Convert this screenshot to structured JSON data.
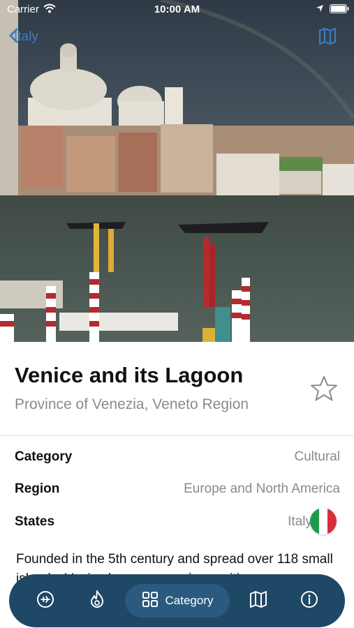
{
  "status_bar": {
    "carrier": "Carrier",
    "time": "10:00 AM"
  },
  "nav": {
    "back_label": "Italy",
    "accent_color": "#3c7cc0"
  },
  "site": {
    "title": "Venice and its Lagoon",
    "subtitle": "Province of Venezia, Veneto Region",
    "favorite_icon": "star-outline-icon"
  },
  "details": [
    {
      "label": "Category",
      "value": "Cultural"
    },
    {
      "label": "Region",
      "value": "Europe and North America"
    },
    {
      "label": "States",
      "value": "Italy",
      "flag": "italy-flag-icon"
    }
  ],
  "description": "Founded in the 5th century and spread over 118 small islands, Venice became a major maritime",
  "tab_bar": {
    "background": "#1f4766",
    "items": [
      {
        "icon": "airplane-icon",
        "label": ""
      },
      {
        "icon": "fire-icon",
        "label": ""
      },
      {
        "icon": "grid-icon",
        "label": "Category",
        "selected": true
      },
      {
        "icon": "map-icon",
        "label": ""
      },
      {
        "icon": "info-icon",
        "label": ""
      }
    ]
  }
}
